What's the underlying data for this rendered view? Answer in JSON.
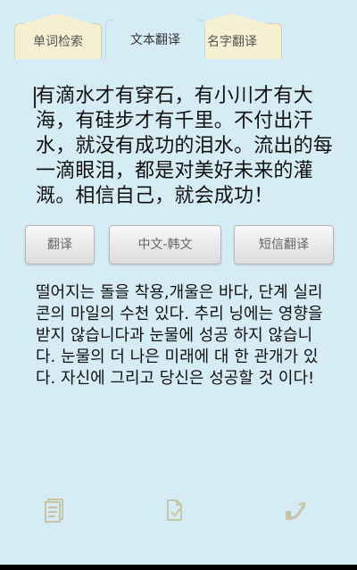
{
  "tabs": [
    {
      "label": "单词检索"
    },
    {
      "label": "文本翻译"
    },
    {
      "label": "名字翻译"
    }
  ],
  "source_text": "有滴水才有穿石，有小川才有大海，有硅步才有千里。不付出汗水，就没有成功的泪水。流出的每一滴眼泪，都是对美好未来的灌溉。相信自己，就会成功！",
  "buttons": {
    "translate": "翻译",
    "direction": "中文-韩文",
    "sms_translate": "短信翻译"
  },
  "result_text": "떨어지는 돌을 착용,개울은 바다, 단계 실리콘의 마일의 수천 있다. 추리 닝에는 영향을 받지 않습니다과 눈물에 성공 하지 않습니다. 눈물의 더 나은 미래에 대 한 관개가 있다. 자신에 그리고 당신은 성공할 것 이다!",
  "icons": {
    "left": "document-list-icon",
    "middle": "paste-icon",
    "right": "share-icon"
  },
  "colors": {
    "background": "#d6ecf5",
    "tab_inactive": "#f6f0d3",
    "button_text": "#666666"
  }
}
